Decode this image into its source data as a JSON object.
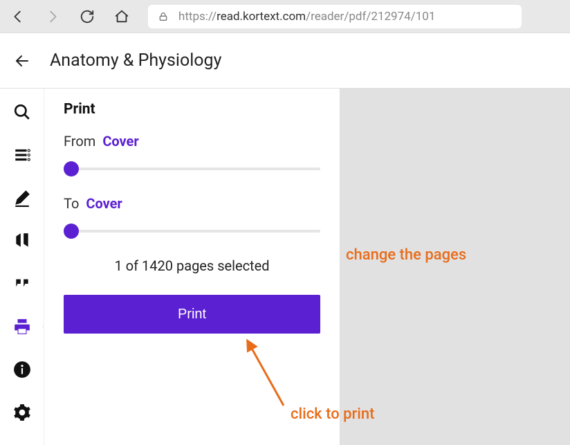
{
  "browser": {
    "url_prefix": "https://",
    "url_domain": "read.kortext.com",
    "url_path": "/reader/pdf/212974/101"
  },
  "header": {
    "title": "Anatomy & Physiology"
  },
  "sidebar": {
    "items": [
      {
        "name": "search"
      },
      {
        "name": "contents"
      },
      {
        "name": "notes"
      },
      {
        "name": "bookmarks"
      },
      {
        "name": "quotes"
      },
      {
        "name": "print"
      },
      {
        "name": "info"
      },
      {
        "name": "settings"
      }
    ]
  },
  "panel": {
    "title": "Print",
    "from_label": "From",
    "from_value": "Cover",
    "to_label": "To",
    "to_value": "Cover",
    "status": "1 of 1420 pages selected",
    "print_button": "Print"
  },
  "annotations": {
    "change_pages": "change the pages",
    "click_to_print": "click to print"
  }
}
